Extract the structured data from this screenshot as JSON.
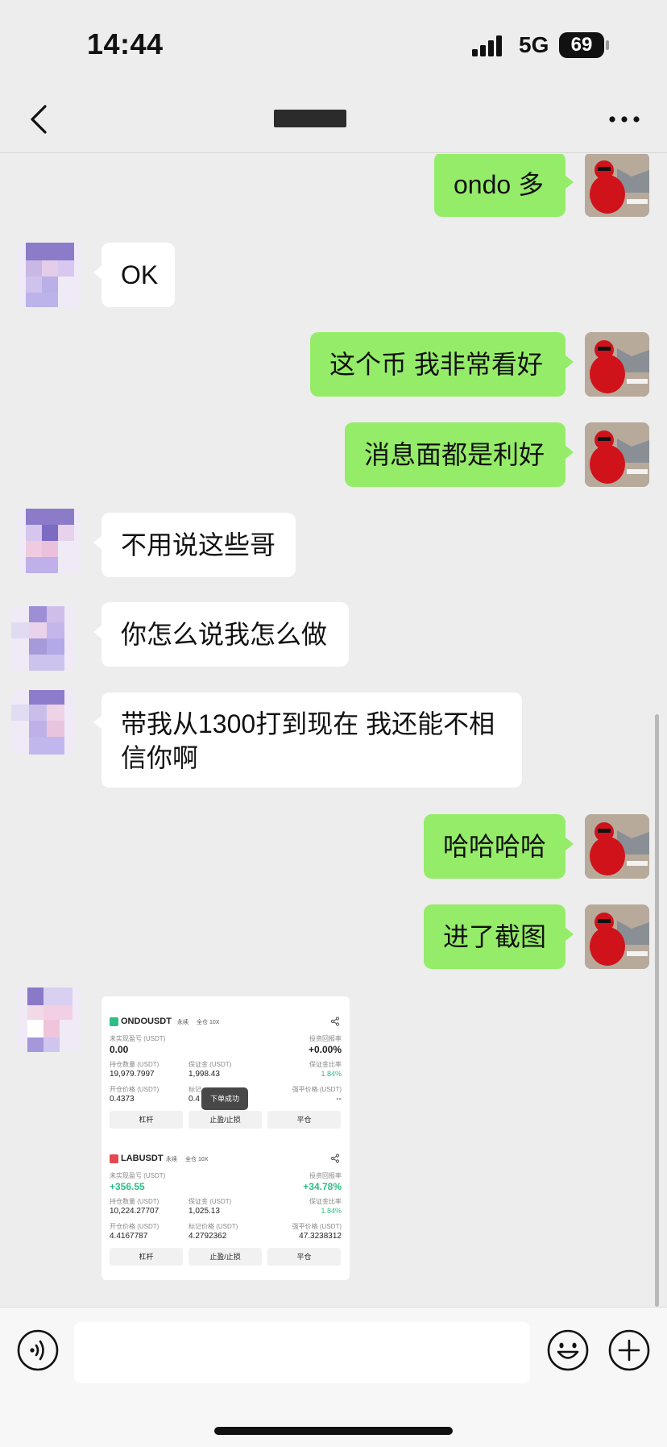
{
  "status_bar": {
    "time": "14:44",
    "network": "5G",
    "battery": "69"
  },
  "nav": {
    "title": "█████"
  },
  "messages": [
    {
      "side": "mine",
      "text": "ondo 多"
    },
    {
      "side": "theirs",
      "text": "OK"
    },
    {
      "side": "mine",
      "text": "这个币 我非常看好"
    },
    {
      "side": "mine",
      "text": "消息面都是利好"
    },
    {
      "side": "theirs",
      "text": "不用说这些哥"
    },
    {
      "side": "theirs",
      "text": "你怎么说我怎么做"
    },
    {
      "side": "theirs",
      "text": "带我从1300打到现在 我还能不相信你啊"
    },
    {
      "side": "mine",
      "text": "哈哈哈哈"
    },
    {
      "side": "mine",
      "text": "进了截图"
    }
  ],
  "screenshot": {
    "toast": "下单成功",
    "positions": [
      {
        "symbol": "ONDOUSDT",
        "type": "永续",
        "margin_mode": "全仓 10X",
        "badge_color": "#2ebd85",
        "unrealized_label": "未实现盈亏 (USDT)",
        "unrealized": "0.00",
        "roi_label": "投资回报率",
        "roi": "+0.00%",
        "size_label": "持仓数量 (USDT)",
        "size": "19,979.7997",
        "margin_label": "保证金 (USDT)",
        "margin": "1,998.43",
        "margin_ratio_label": "保证金比率",
        "margin_ratio": "1.84%",
        "entry_label": "开仓价格 (USDT)",
        "entry": "0.4373",
        "mark_label": "标记",
        "mark": "0.4",
        "liq_label": "强平价格 (USDT)",
        "liq": "--",
        "buttons": [
          "杠杆",
          "止盈/止损",
          "平仓"
        ]
      },
      {
        "symbol": "LABUSDT",
        "type": "永续",
        "margin_mode": "全仓 10X",
        "badge_color": "#e5484d",
        "unrealized_label": "未实现盈亏 (USDT)",
        "unrealized": "+356.55",
        "roi_label": "投资回报率",
        "roi": "+34.78%",
        "size_label": "持仓数量 (USDT)",
        "size": "10,224.27707",
        "margin_label": "保证金 (USDT)",
        "margin": "1,025.13",
        "margin_ratio_label": "保证金比率",
        "margin_ratio": "1.84%",
        "entry_label": "开仓价格 (USDT)",
        "entry": "4.4167787",
        "mark_label": "标记价格 (USDT)",
        "mark": "4.2792362",
        "liq_label": "强平价格 (USDT)",
        "liq": "47.3238312",
        "buttons": [
          "杠杆",
          "止盈/止损",
          "平仓"
        ]
      }
    ]
  },
  "input": {
    "placeholder": "",
    "value": ""
  },
  "icons": {
    "back": "back-chevron-icon",
    "more": "more-dots-icon",
    "voice": "voice-icon",
    "emoji": "emoji-icon",
    "plus": "plus-icon",
    "share": "share-icon",
    "signal": "signal-icon"
  }
}
